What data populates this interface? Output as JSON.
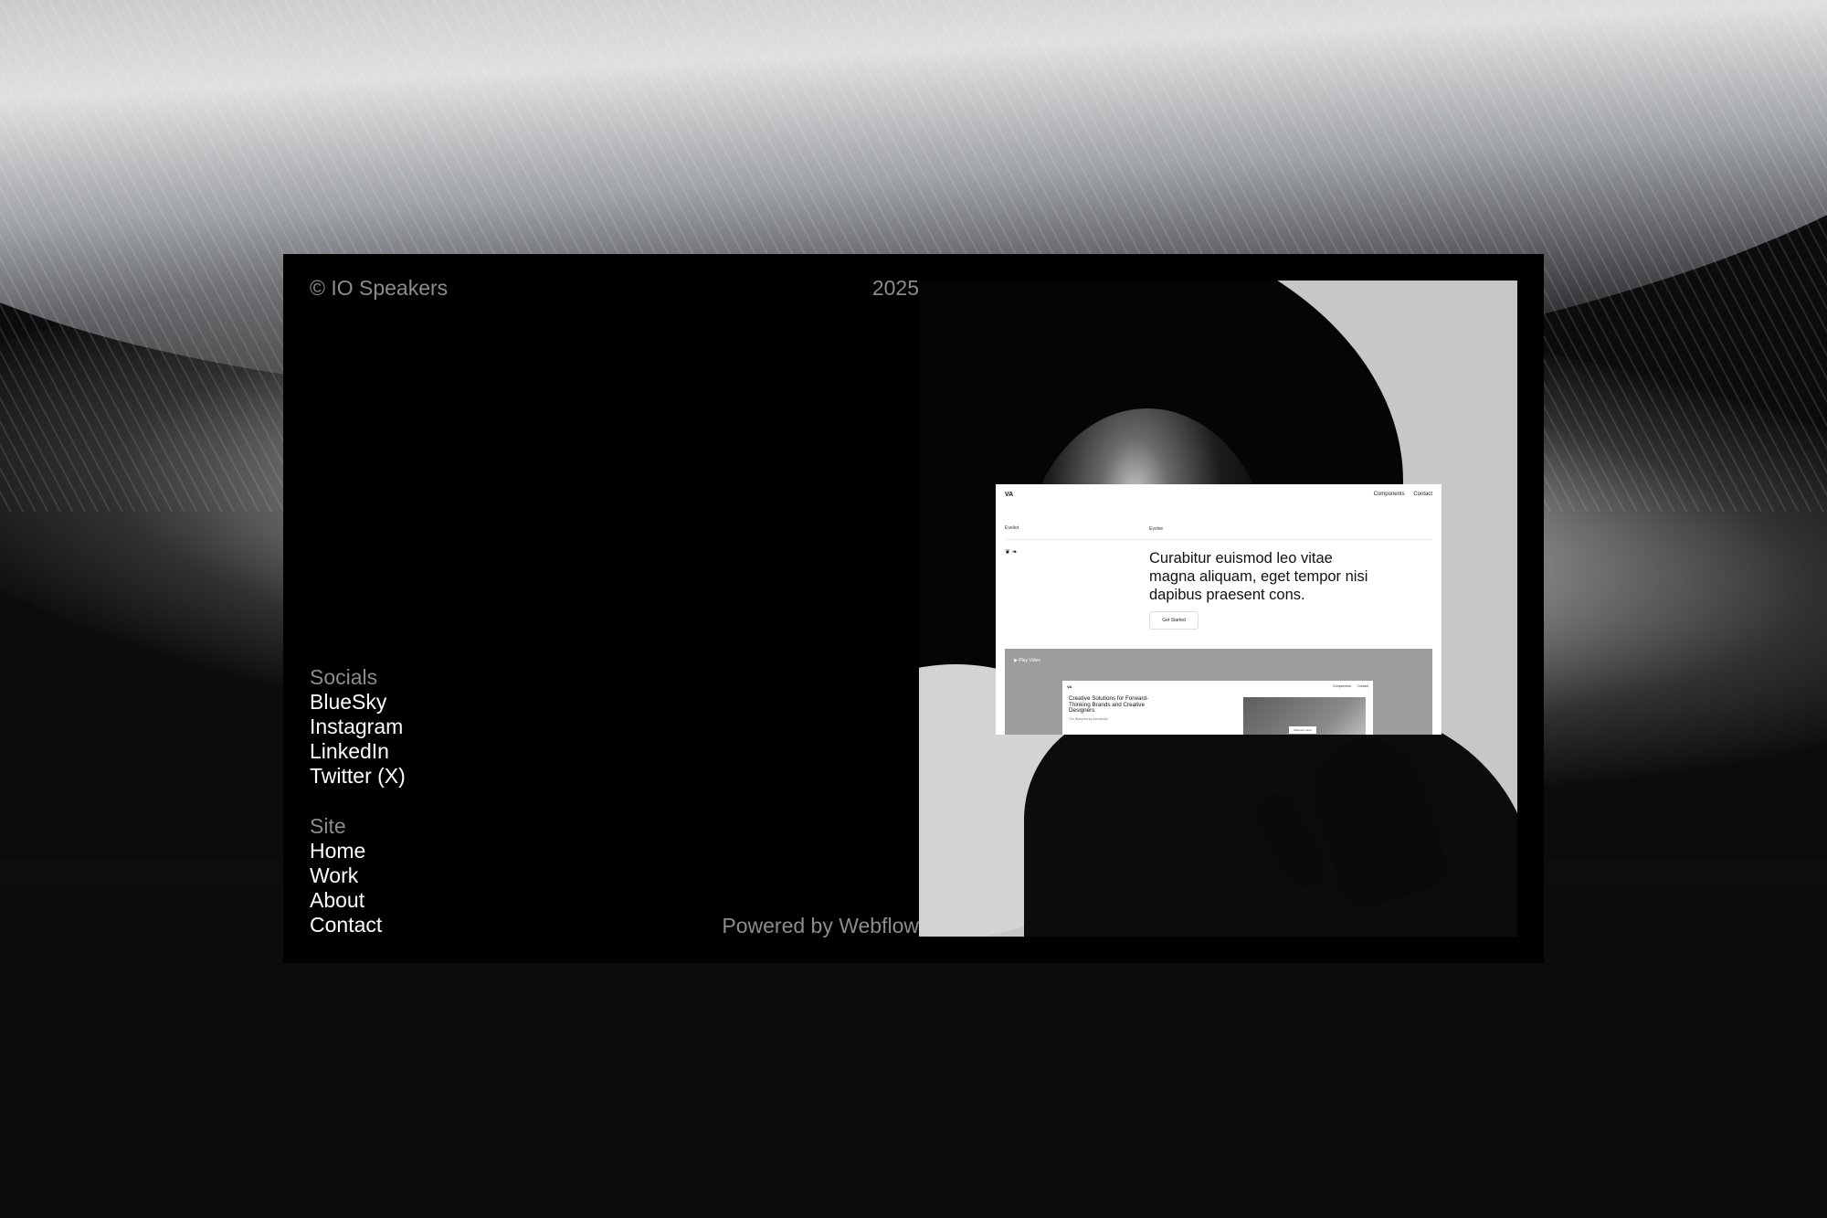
{
  "header": {
    "brand": "© IO Speakers",
    "year": "2025"
  },
  "socials": {
    "heading": "Socials",
    "links": [
      "BlueSky",
      "Instagram",
      "LinkedIn",
      "Twitter (X)"
    ]
  },
  "site": {
    "heading": "Site",
    "links": [
      "Home",
      "Work",
      "About",
      "Contact"
    ]
  },
  "footer": {
    "powered": "Powered by Webflow"
  },
  "mockup": {
    "logo": "VA",
    "nav": [
      "Components",
      "Contact"
    ],
    "label_left": "Eveliot",
    "label_right": "Evolve",
    "social_icons": "❦ ❧",
    "headline": "Curabitur euismod leo vitae magna aliquam, eget tempor nisi dapibus praesent cons.",
    "button": "Get Started",
    "video_label": "▶ Play Video",
    "inner": {
      "logo": "VA",
      "nav": [
        "Components",
        "Contact"
      ],
      "title": "Creative Solutions for Forward-Thinking Brands and Creative Designers",
      "subtitle": "The Blueprint by Aerostudio",
      "chip": "Discover more"
    }
  },
  "colors": {
    "card": "#000000",
    "muted_text": "#8c8c8c",
    "link_text": "#ffffff"
  }
}
